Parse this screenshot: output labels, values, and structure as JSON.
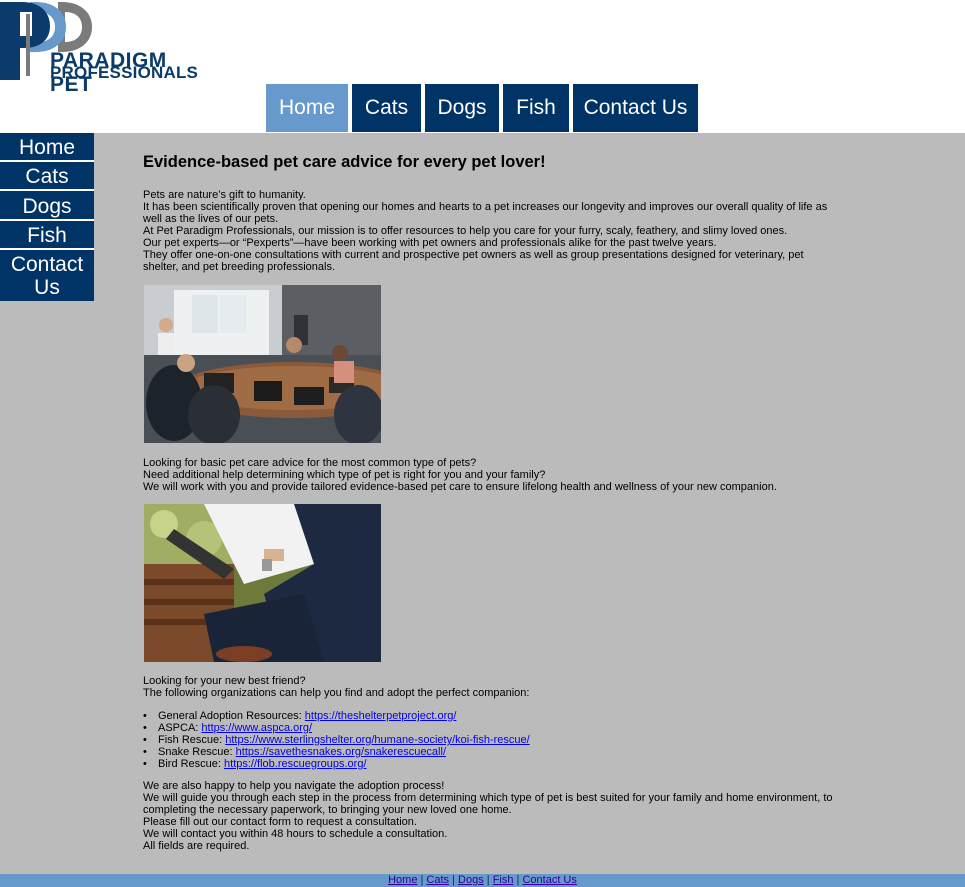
{
  "brand": {
    "line1": "PARADIGM PET",
    "line2": "PROFESSIONALS",
    "logo_color": "#0a3b6a",
    "logo_gray": "#7b7b7b",
    "logo_light": "#6699cc"
  },
  "top_nav": [
    {
      "label": "Home",
      "active": true
    },
    {
      "label": "Cats",
      "active": false
    },
    {
      "label": "Dogs",
      "active": false
    },
    {
      "label": "Fish",
      "active": false
    },
    {
      "label": "Contact Us",
      "active": false
    }
  ],
  "side_nav": [
    {
      "label": "Home"
    },
    {
      "label": "Cats"
    },
    {
      "label": "Dogs"
    },
    {
      "label": "Fish"
    },
    {
      "label": "Contact Us"
    }
  ],
  "main": {
    "title": "Evidence-based pet care advice for every pet lover!",
    "intro": [
      "Pets are nature’s gift to humanity.",
      "It has been scientifically proven that opening our homes and hearts to a pet increases our longevity and improves our overall quality of life as well as the lives of our pets.",
      "At Pet Paradigm Professionals, our mission is to offer resources to help you care for your furry, scaly, feathery, and slimy loved ones.",
      "Our pet experts—or “Pexperts”—have been working with pet owners and professionals alike for the past twelve years.",
      "They offer one-on-one consultations with current and prospective pet owners as well as group presentations designed for veterinary, pet shelter, and pet breeding professionals."
    ],
    "advice": [
      "Looking for basic pet care advice for the most common type of pets?",
      "Need additional help determining which type of pet is right for you and your family?",
      "We will work with you and provide tailored evidence-based pet care to ensure lifelong health and wellness of your new companion."
    ],
    "adopt_intro": [
      "Looking for your new best friend?",
      "The following organizations can help you find and adopt the perfect companion:"
    ],
    "resources": [
      {
        "label": "General Adoption Resources: ",
        "url": "https://theshelterpetproject.org/"
      },
      {
        "label": "ASPCA: ",
        "url": "https://www.aspca.org/"
      },
      {
        "label": "Fish Rescue: ",
        "url": "https://www.sterlingshelter.org/humane-society/koi-fish-rescue/"
      },
      {
        "label": "Snake Rescue: ",
        "url": "https://savethesnakes.org/snakerescuecall/"
      },
      {
        "label": "Bird Rescue: ",
        "url": "https://flob.rescuegroups.org/"
      }
    ],
    "closing": [
      "We are also happy to help you navigate the adoption process!",
      "We will guide you through each step in the process from determining which type of pet is best suited for your family and home environment, to completing the necessary paperwork, to bringing your new loved one home.",
      "Please fill out our contact form to request a consultation.",
      "We will contact you within 48 hours to schedule a consultation.",
      "All fields are required."
    ]
  },
  "footer": {
    "links": [
      "Home",
      "Cats",
      "Dogs",
      "Fish",
      "Contact Us"
    ],
    "separator": "|"
  },
  "colors": {
    "nav_dark": "#003366",
    "nav_active": "#6699cc",
    "content_bg": "#bbbbbb",
    "footer_bg": "#6699cc",
    "link": "#0000ee"
  }
}
